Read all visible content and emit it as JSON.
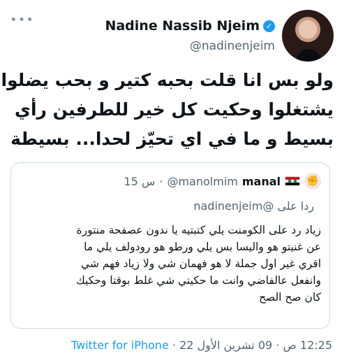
{
  "header": {
    "more_icon": "more-dots-icon",
    "display_name": "Nadine Nassib Njeim",
    "handle": "@nadinenjeim",
    "verified_icon": "verified-badge-icon",
    "accent": "#1d9bf0"
  },
  "tweet": {
    "lines": [
      "ولو بس انا قلت بحبه كتير و بحب يضلوا",
      "يشتغلوا وحكيت كل خير للطرفين رأي",
      "بسيط و ما في اي تحيّز لحدا... بسيطة"
    ]
  },
  "quote": {
    "author_name": "manal",
    "author_handle": "@manolmim",
    "separator": "·",
    "time": "15 س",
    "flag_icon": "syria-flag-icon",
    "reply_prefix": "ردا على",
    "reply_to": "@nadinenjeim",
    "lines": [
      "زياد رد على الكومنت يلي كتبتيه يا ندون عصفحة منتورة",
      "عن غنيتو هو واليسا بس يلي ورطو هو رودولف يلي ما",
      "اقري غير اول جملة لا هو فهمان شي ولا زياد فهم شي",
      "وانفعل عالفاضي وانت ما حكيتي شي غلط بوقتا وحكيك",
      "كان صح الصح"
    ]
  },
  "footer": {
    "time": "12:25 ص",
    "separator": "·",
    "date": "09 تشرين الأول 22",
    "source": "Twitter for iPhone"
  }
}
